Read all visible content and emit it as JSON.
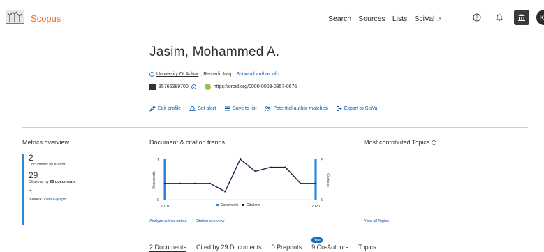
{
  "header": {
    "brand": "Scopus",
    "nav": [
      "Search",
      "Sources",
      "Lists",
      "SciVal"
    ],
    "nav_external_mark": "↗",
    "avatar_initials": "KD"
  },
  "profile": {
    "name": "Jasim, Mohammed A.",
    "affiliation": "University Of Anbar",
    "location": ", Ramadi, Iraq",
    "show_all_link": "Show all author info",
    "scopus_id": "35765389700",
    "orcid_url": "https://orcid.org/0000-0003-0857-0676"
  },
  "actions": [
    "Edit profile",
    "Set alert",
    "Save to list",
    "Potential author matches",
    "Export to SciVal"
  ],
  "metrics": {
    "title": "Metrics overview",
    "documents_value": "2",
    "documents_label": "Documents by author",
    "citations_value": "29",
    "citations_label_pre": "Citations by ",
    "citations_label_bold": "29 documents",
    "hindex_value": "1",
    "hindex_label": "h-index:",
    "hindex_link": "View h-graph"
  },
  "trends": {
    "title": "Document & citation trends",
    "analyze_link": "Analyze author output",
    "citation_link": "Citation overview"
  },
  "topics": {
    "title": "Most contributed Topics",
    "view_all": "View all Topics"
  },
  "tabs": [
    "2 Documents",
    "Cited by 29 Documents",
    "0 Preprints",
    "9 Co-Authors",
    "Topics"
  ],
  "new_badge": "New",
  "colors": {
    "brand": "#e9711c",
    "link": "#0656ad",
    "doc_bar": "#2e86de",
    "citation_line": "#1c1f4a"
  },
  "chart_data": {
    "type": "line",
    "x_start": "2010",
    "x_end": "2020",
    "x": [
      2010,
      2011,
      2012,
      2013,
      2014,
      2015,
      2016,
      2017,
      2018,
      2019,
      2020
    ],
    "series": [
      {
        "name": "Documents",
        "values": [
          1,
          0,
          0,
          0,
          0,
          0,
          0,
          0,
          0,
          0,
          1
        ]
      },
      {
        "name": "Citations",
        "values": [
          2,
          2,
          2,
          2,
          1,
          5,
          3.5,
          4,
          4,
          2,
          2
        ]
      }
    ],
    "ylabel_left": "Documents",
    "ylabel_right": "Citations",
    "yleft_ticks": [
      "1",
      "0"
    ],
    "yright_ticks": [
      "5",
      "0"
    ],
    "ylim_left": [
      0,
      1
    ],
    "ylim_right": [
      0,
      5
    ],
    "legend": [
      "Documents",
      "Citations"
    ],
    "legend_position": "bottom"
  }
}
